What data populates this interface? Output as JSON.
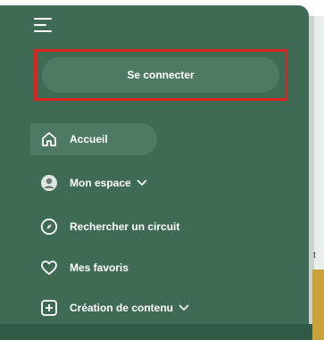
{
  "login": {
    "label": "Se connecter"
  },
  "nav": {
    "items": [
      {
        "label": "Accueil",
        "icon": "home-icon"
      },
      {
        "label": "Mon espace",
        "icon": "user-avatar-icon"
      },
      {
        "label": "Rechercher un circuit",
        "icon": "compass-icon"
      },
      {
        "label": "Mes favoris",
        "icon": "heart-icon"
      },
      {
        "label": "Création de contenu",
        "icon": "plus-square-icon"
      }
    ]
  },
  "right_panel": {
    "visible_letter": "t"
  },
  "colors": {
    "sidebar_bg": "#3f6b54",
    "button_bg": "#4e7a63",
    "highlight_border": "#e02424",
    "text": "#ffffff"
  }
}
